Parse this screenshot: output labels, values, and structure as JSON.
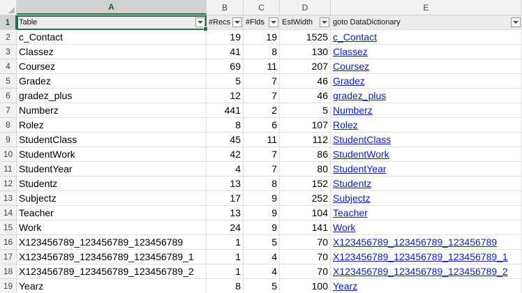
{
  "columns": [
    "A",
    "B",
    "C",
    "D",
    "E"
  ],
  "header": [
    "Table",
    "#Recs",
    "#Flds",
    "EstWidth",
    "goto DataDictionary"
  ],
  "rows": [
    {
      "n": "2",
      "name": "c_Contact",
      "recs": "19",
      "flds": "19",
      "w": "1525",
      "link": "c_Contact"
    },
    {
      "n": "3",
      "name": "Classez",
      "recs": "41",
      "flds": "8",
      "w": "130",
      "link": "Classez"
    },
    {
      "n": "4",
      "name": "Coursez",
      "recs": "69",
      "flds": "11",
      "w": "207",
      "link": "Coursez"
    },
    {
      "n": "5",
      "name": "Gradez",
      "recs": "5",
      "flds": "7",
      "w": "46",
      "link": "Gradez"
    },
    {
      "n": "6",
      "name": "gradez_plus",
      "recs": "12",
      "flds": "7",
      "w": "46",
      "link": "gradez_plus"
    },
    {
      "n": "7",
      "name": "Numberz",
      "recs": "441",
      "flds": "2",
      "w": "5",
      "link": "Numberz"
    },
    {
      "n": "8",
      "name": "Rolez",
      "recs": "8",
      "flds": "6",
      "w": "107",
      "link": "Rolez"
    },
    {
      "n": "9",
      "name": "StudentClass",
      "recs": "45",
      "flds": "11",
      "w": "112",
      "link": "StudentClass"
    },
    {
      "n": "10",
      "name": "StudentWork",
      "recs": "42",
      "flds": "7",
      "w": "86",
      "link": "StudentWork"
    },
    {
      "n": "11",
      "name": "StudentYear",
      "recs": "4",
      "flds": "7",
      "w": "80",
      "link": "StudentYear"
    },
    {
      "n": "12",
      "name": "Studentz",
      "recs": "13",
      "flds": "8",
      "w": "152",
      "link": "Studentz"
    },
    {
      "n": "13",
      "name": "Subjectz",
      "recs": "17",
      "flds": "9",
      "w": "252",
      "link": "Subjectz"
    },
    {
      "n": "14",
      "name": "Teacher",
      "recs": "13",
      "flds": "9",
      "w": "104",
      "link": "Teacher"
    },
    {
      "n": "15",
      "name": "Work",
      "recs": "24",
      "flds": "9",
      "w": "141",
      "link": "Work"
    },
    {
      "n": "16",
      "name": "X123456789_123456789_123456789",
      "recs": "1",
      "flds": "5",
      "w": "70",
      "link": "X123456789_123456789_123456789"
    },
    {
      "n": "17",
      "name": "X123456789_123456789_123456789_1",
      "recs": "1",
      "flds": "4",
      "w": "70",
      "link": "X123456789_123456789_123456789_1"
    },
    {
      "n": "18",
      "name": "X123456789_123456789_123456789_2",
      "recs": "1",
      "flds": "4",
      "w": "70",
      "link": "X123456789_123456789_123456789_2"
    },
    {
      "n": "19",
      "name": "Yearz",
      "recs": "8",
      "flds": "5",
      "w": "100",
      "link": "Yearz"
    }
  ]
}
